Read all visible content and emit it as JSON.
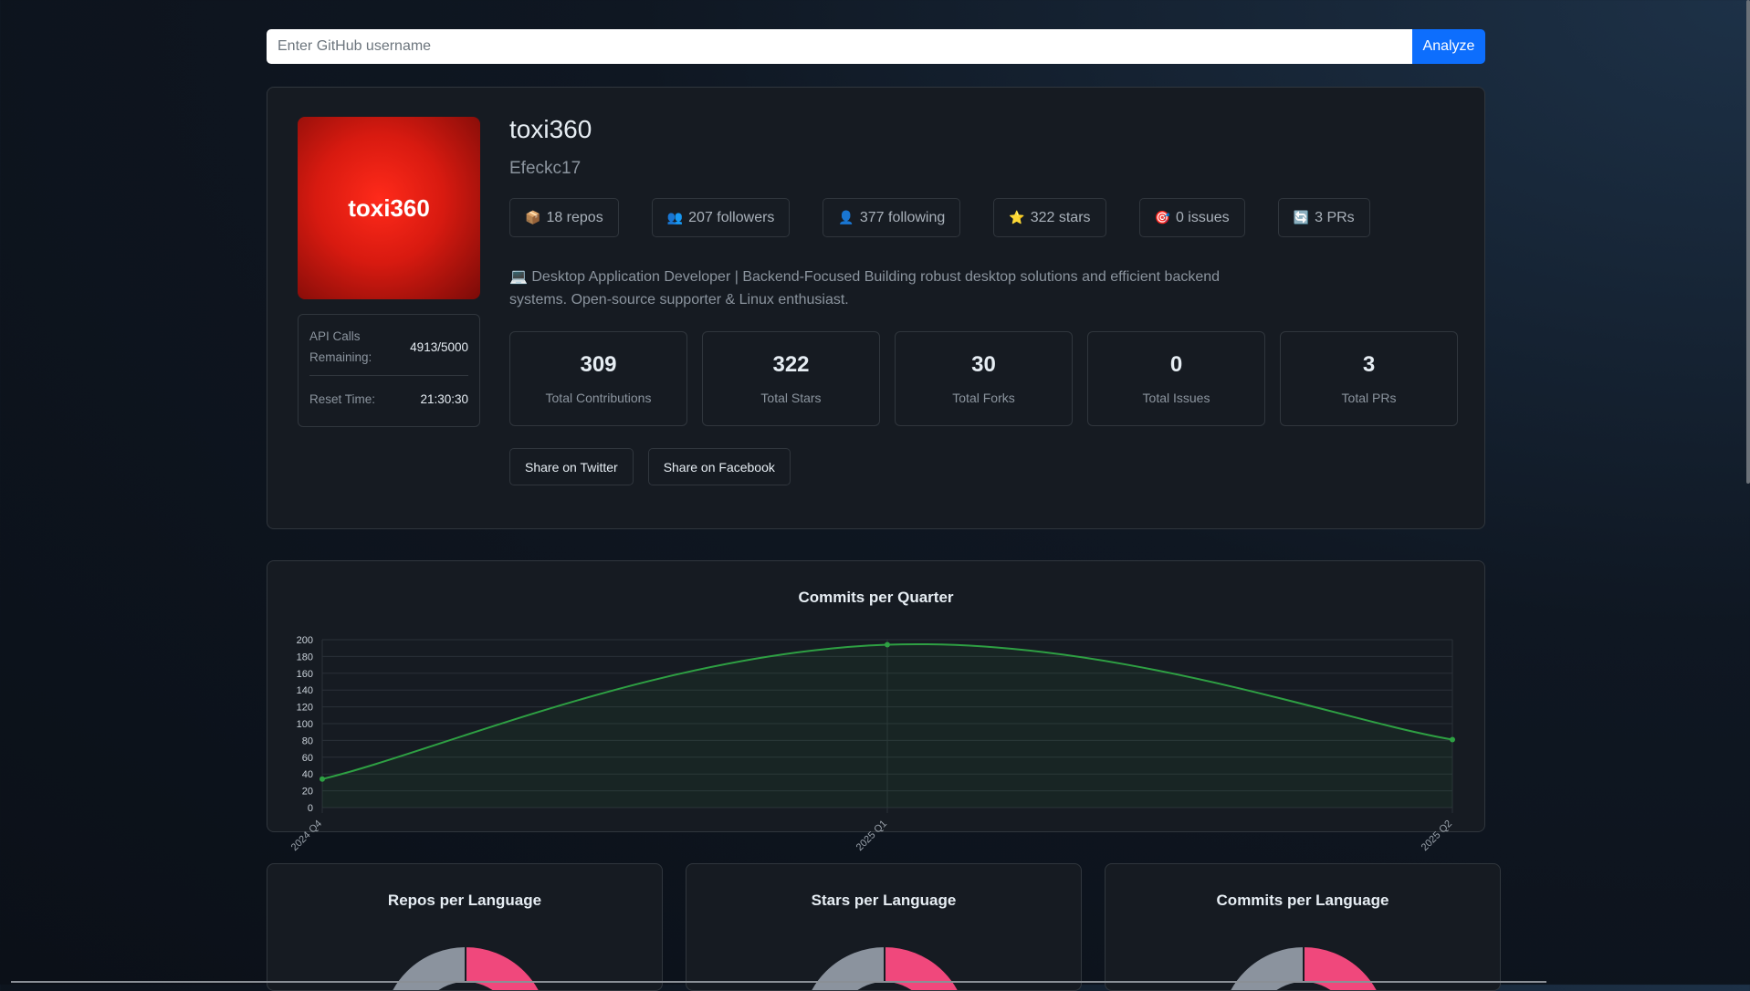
{
  "search": {
    "placeholder": "Enter GitHub username",
    "button": "Analyze"
  },
  "profile": {
    "avatar_text": "toxi360",
    "name": "toxi360",
    "login": "Efeckc17",
    "api": {
      "calls_label": "API Calls Remaining:",
      "calls_value": "4913/5000",
      "reset_label": "Reset Time:",
      "reset_value": "21:30:30"
    },
    "badges": [
      {
        "icon": "package-icon",
        "glyph": "📦",
        "label": "18 repos"
      },
      {
        "icon": "people-icon",
        "glyph": "👥",
        "label": "207 followers"
      },
      {
        "icon": "person-icon",
        "glyph": "👤",
        "label": "377 following"
      },
      {
        "icon": "star-icon",
        "glyph": "⭐",
        "label": "322 stars"
      },
      {
        "icon": "target-icon",
        "glyph": "🎯",
        "label": "0 issues"
      },
      {
        "icon": "refresh-icon",
        "glyph": "🔄",
        "label": "3 PRs"
      }
    ],
    "bio_glyph": "💻",
    "bio": "Desktop Application Developer | Backend-Focused Building robust desktop solutions and efficient backend systems. Open-source supporter & Linux enthusiast.",
    "stats": [
      {
        "value": "309",
        "label": "Total Contributions"
      },
      {
        "value": "322",
        "label": "Total Stars"
      },
      {
        "value": "30",
        "label": "Total Forks"
      },
      {
        "value": "0",
        "label": "Total Issues"
      },
      {
        "value": "3",
        "label": "Total PRs"
      }
    ],
    "share": {
      "twitter": "Share on Twitter",
      "facebook": "Share on Facebook"
    }
  },
  "chart_data": {
    "type": "line",
    "title": "Commits per Quarter",
    "categories": [
      "2024 Q4",
      "2025 Q1",
      "2025 Q2"
    ],
    "values": [
      34,
      194,
      81
    ],
    "ylim": [
      0,
      200
    ],
    "yticks": [
      0,
      20,
      40,
      60,
      80,
      100,
      120,
      140,
      160,
      180,
      200
    ],
    "grid": true,
    "fill": true,
    "color": "#2ea043"
  },
  "language_charts": [
    {
      "title": "Repos per Language"
    },
    {
      "title": "Stars per Language"
    },
    {
      "title": "Commits per Language"
    }
  ],
  "colors": {
    "accent": "#0d6efd",
    "pie_gray": "#8b939e",
    "pie_pink": "#f0487c"
  }
}
